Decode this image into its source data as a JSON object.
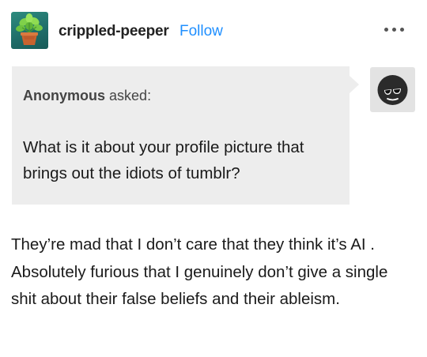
{
  "post": {
    "blog_name": "crippled-peeper",
    "follow_label": "Follow",
    "more_icon": "more-options-icon",
    "avatar_icon": "potted-plant-avatar-icon"
  },
  "ask": {
    "asker": "Anonymous",
    "asked_label": "asked:",
    "question": "What is it about your profile picture that brings out the idiots of tumblr?",
    "asker_avatar_icon": "anonymous-sunglasses-avatar-icon"
  },
  "answer": {
    "text": "They’re mad that I don’t care that they think it’s AI . Absolutely furious that I genuinely don’t give a single shit about their false beliefs and their ableism."
  },
  "colors": {
    "follow": "#1f8fff",
    "bubble": "#ededed",
    "text": "#1a1a1a"
  }
}
